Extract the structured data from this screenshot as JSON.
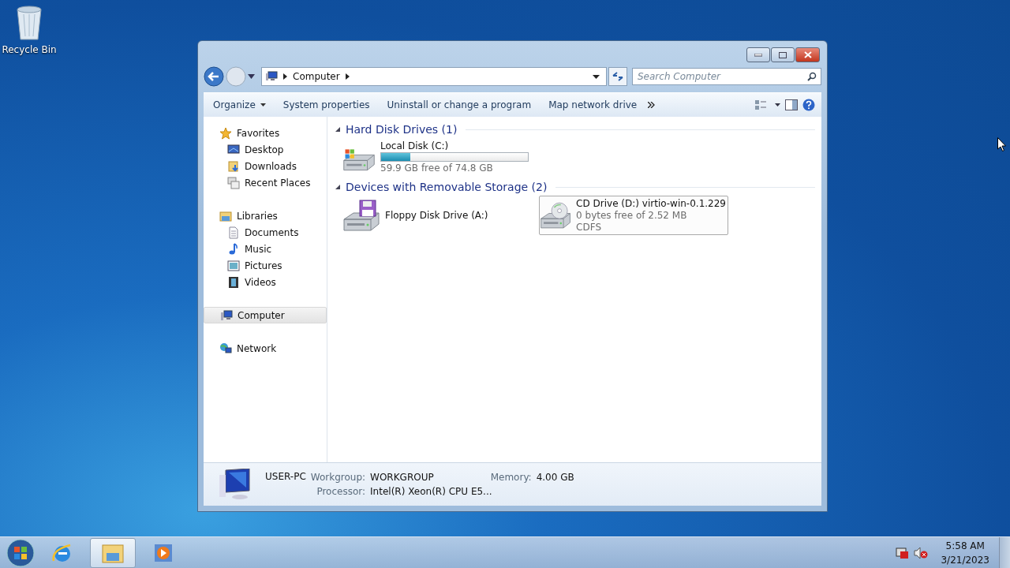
{
  "desktop": {
    "icons": [
      {
        "label": "Recycle Bin"
      }
    ]
  },
  "window": {
    "address": {
      "path": [
        "Computer"
      ]
    },
    "search": {
      "placeholder": "Search Computer"
    },
    "toolbar": {
      "items": [
        {
          "label": "Organize",
          "dropdown": true
        },
        {
          "label": "System properties",
          "dropdown": false
        },
        {
          "label": "Uninstall or change a program",
          "dropdown": false
        },
        {
          "label": "Map network drive",
          "dropdown": false
        }
      ]
    },
    "nav": [
      {
        "label": "Favorites",
        "kind": "star",
        "selected": false,
        "children": [
          {
            "label": "Desktop",
            "kind": "monitor",
            "selected": false
          },
          {
            "label": "Downloads",
            "kind": "folder",
            "selected": false
          },
          {
            "label": "Recent Places",
            "kind": "recent",
            "selected": false
          }
        ]
      },
      {
        "label": "Libraries",
        "kind": "folder",
        "selected": false,
        "children": [
          {
            "label": "Documents",
            "kind": "document",
            "selected": false
          },
          {
            "label": "Music",
            "kind": "music",
            "selected": false
          },
          {
            "label": "Pictures",
            "kind": "picture",
            "selected": false
          },
          {
            "label": "Videos",
            "kind": "film",
            "selected": false
          }
        ]
      },
      {
        "label": "Computer",
        "kind": "computer",
        "selected": true
      },
      {
        "label": "Network",
        "kind": "network",
        "selected": false
      }
    ],
    "groups": [
      {
        "title": "Hard Disk Drives (1)",
        "items": [
          {
            "kind": "hdd",
            "name": "Local Disk (C:)",
            "level": 0.2,
            "free": "59.9 GB free of 74.8 GB",
            "selected": false
          }
        ]
      },
      {
        "title": "Devices with Removable Storage (2)",
        "items": [
          {
            "kind": "floppy",
            "name": "Floppy Disk Drive (A:)",
            "selected": false
          },
          {
            "kind": "cd",
            "name": "CD Drive (D:) virtio-win-0.1.229",
            "free": "0 bytes free of 2.52 MB",
            "fs": "CDFS",
            "selected": true
          }
        ]
      }
    ],
    "details": {
      "name": "USER-PC",
      "fields": [
        {
          "label": "Workgroup:",
          "value": "WORKGROUP"
        },
        {
          "label": "Memory:",
          "value": "4.00 GB"
        },
        {
          "label": "Processor:",
          "value": "Intel(R) Xeon(R) CPU E5..."
        }
      ]
    }
  },
  "taskbar": {
    "apps": [
      {
        "kind": "ie",
        "selected": false
      },
      {
        "kind": "explorer",
        "selected": true
      },
      {
        "kind": "media",
        "selected": false
      }
    ],
    "time": "5:58 AM",
    "date": "3/21/2023"
  }
}
